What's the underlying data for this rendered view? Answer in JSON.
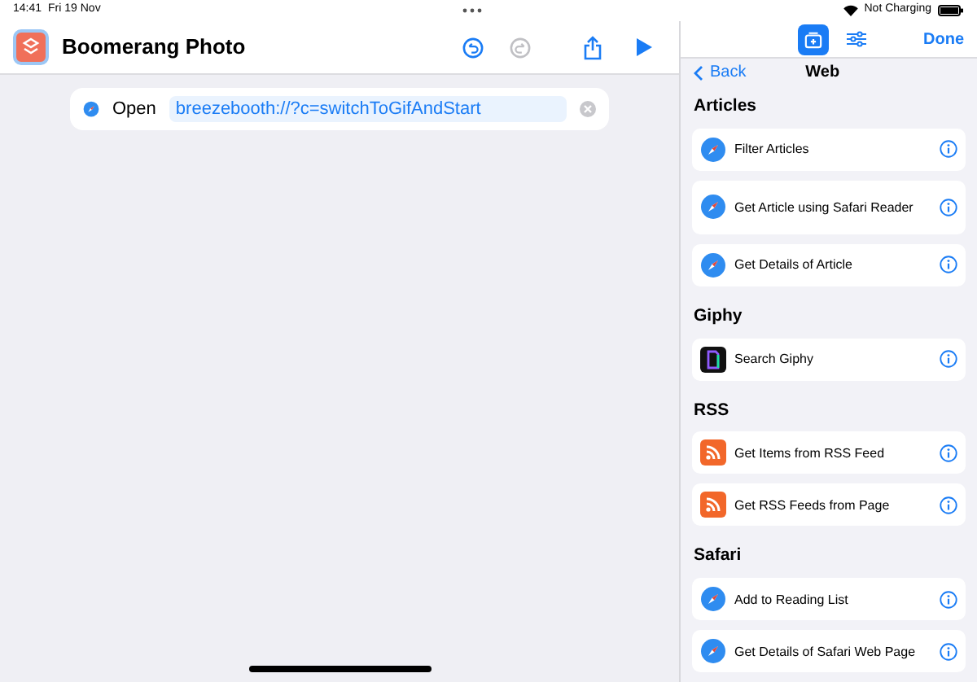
{
  "status_bar": {
    "time": "14:41",
    "date": "Fri 19 Nov",
    "charging": "Not Charging"
  },
  "editor": {
    "title": "Boomerang Photo",
    "undo_enabled": true,
    "redo_enabled": false,
    "action": {
      "verb": "Open",
      "value": "breezebooth://?c=switchToGifAndStart"
    }
  },
  "sidebar": {
    "tabs": [
      {
        "kind": "library",
        "selected": true
      },
      {
        "kind": "settings",
        "selected": false
      }
    ],
    "done": "Done",
    "back": "Back",
    "title": "Web",
    "sections": [
      {
        "title": "Articles",
        "items": [
          {
            "label": "Filter Articles",
            "kind": "safari"
          },
          {
            "label": "Get Article using Safari Reader",
            "kind": "safari"
          },
          {
            "label": "Get Details of Article",
            "kind": "safari"
          }
        ]
      },
      {
        "title": "Giphy",
        "items": [
          {
            "label": "Search Giphy",
            "kind": "giphy"
          }
        ]
      },
      {
        "title": "RSS",
        "items": [
          {
            "label": "Get Items from RSS Feed",
            "kind": "rss"
          },
          {
            "label": "Get RSS Feeds from Page",
            "kind": "rss"
          }
        ]
      },
      {
        "title": "Safari",
        "items": [
          {
            "label": "Add to Reading List",
            "kind": "safari"
          },
          {
            "label": "Get Details of Safari Web Page",
            "kind": "safari"
          }
        ]
      }
    ]
  }
}
